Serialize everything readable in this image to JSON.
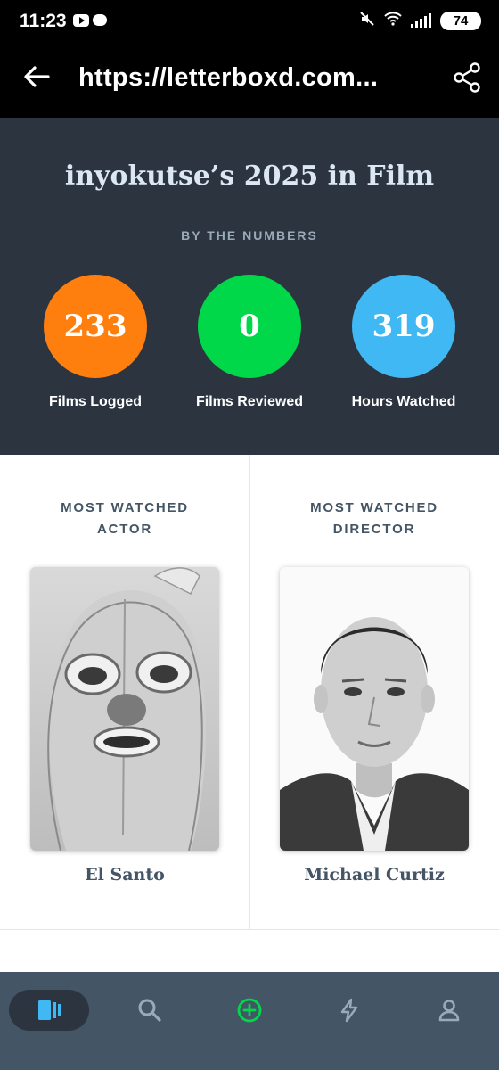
{
  "status_bar": {
    "time": "11:23",
    "battery": "74",
    "icons": [
      "youtube-icon",
      "chat-icon",
      "mute-icon",
      "wifi-icon",
      "signal-icon",
      "battery-icon"
    ]
  },
  "app_bar": {
    "url": "https://letterboxd.com...",
    "icons": [
      "back-arrow-icon",
      "share-icon"
    ]
  },
  "stats": {
    "title": "inyokutse’s 2025 in Film",
    "kicker": "BY THE NUMBERS",
    "items": [
      {
        "value": "233",
        "label": "Films Logged",
        "color": "#ff7f0e"
      },
      {
        "value": "0",
        "label": "Films Reviewed",
        "color": "#00d84a"
      },
      {
        "value": "319",
        "label": "Hours Watched",
        "color": "#40b8f4"
      }
    ]
  },
  "most_watched": {
    "actor": {
      "heading_line1": "MOST WATCHED",
      "heading_line2": "ACTOR",
      "name": "El Santo"
    },
    "director": {
      "heading_line1": "MOST WATCHED",
      "heading_line2": "DIRECTOR",
      "name": "Michael Curtiz"
    }
  },
  "bottom_nav": {
    "items": [
      "films-icon",
      "search-icon",
      "add-icon",
      "activity-icon",
      "profile-icon"
    ],
    "active": "films-icon"
  },
  "colors": {
    "panel": "#2c3440",
    "nav": "#445566",
    "text_dark": "#445566",
    "accent_green": "#00d84a"
  }
}
